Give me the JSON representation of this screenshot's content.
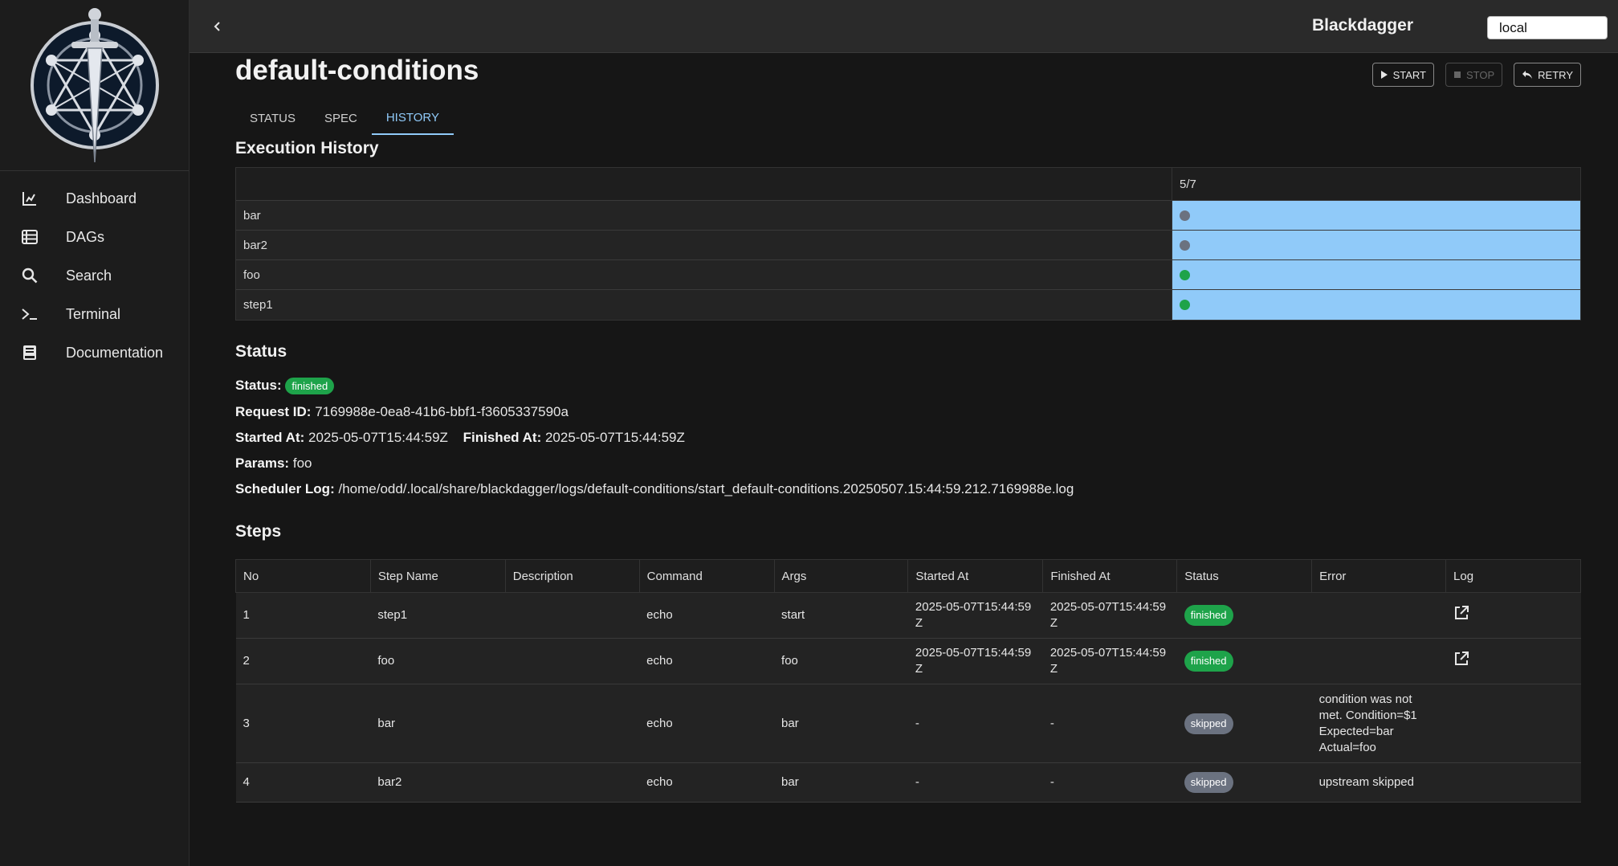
{
  "header": {
    "brand": "Blackdagger",
    "env_value": "local"
  },
  "sidebar": {
    "items": [
      {
        "label": "Dashboard",
        "icon": "chart-icon"
      },
      {
        "label": "DAGs",
        "icon": "list-icon"
      },
      {
        "label": "Search",
        "icon": "search-icon"
      },
      {
        "label": "Terminal",
        "icon": "terminal-icon"
      },
      {
        "label": "Documentation",
        "icon": "book-icon"
      }
    ]
  },
  "page": {
    "title": "default-conditions",
    "actions": {
      "start": "START",
      "stop": "STOP",
      "retry": "RETRY"
    },
    "tabs": [
      {
        "label": "STATUS",
        "active": false
      },
      {
        "label": "SPEC",
        "active": false
      },
      {
        "label": "HISTORY",
        "active": true
      }
    ]
  },
  "history": {
    "title": "Execution History",
    "run_label": "5/7",
    "rows": [
      {
        "name": "bar",
        "dot_color": "#6b7280"
      },
      {
        "name": "bar2",
        "dot_color": "#6b7280"
      },
      {
        "name": "foo",
        "dot_color": "#1ea34a"
      },
      {
        "name": "step1",
        "dot_color": "#1ea34a"
      }
    ]
  },
  "status": {
    "title": "Status",
    "status_label": "Status:",
    "status_value": "finished",
    "request_id_label": "Request ID:",
    "request_id": "7169988e-0ea8-41b6-bbf1-f3605337590a",
    "started_label": "Started At:",
    "started_at": "2025-05-07T15:44:59Z",
    "finished_label": "Finished At:",
    "finished_at": "2025-05-07T15:44:59Z",
    "params_label": "Params:",
    "params": "foo",
    "log_label": "Scheduler Log:",
    "log_path": "/home/odd/.local/share/blackdagger/logs/default-conditions/start_default-conditions.20250507.15:44:59.212.7169988e.log"
  },
  "steps": {
    "title": "Steps",
    "columns": [
      "No",
      "Step Name",
      "Description",
      "Command",
      "Args",
      "Started At",
      "Finished At",
      "Status",
      "Error",
      "Log"
    ],
    "rows": [
      {
        "no": "1",
        "name": "step1",
        "description": "",
        "command": "echo",
        "args": "start",
        "started": "2025-05-07T15:44:59Z",
        "finished": "2025-05-07T15:44:59Z",
        "status": "finished",
        "error": "",
        "has_log": true
      },
      {
        "no": "2",
        "name": "foo",
        "description": "",
        "command": "echo",
        "args": "foo",
        "started": "2025-05-07T15:44:59Z",
        "finished": "2025-05-07T15:44:59Z",
        "status": "finished",
        "error": "",
        "has_log": true
      },
      {
        "no": "3",
        "name": "bar",
        "description": "",
        "command": "echo",
        "args": "bar",
        "started": "-",
        "finished": "-",
        "status": "skipped",
        "error": "condition was not met. Condition=$1 Expected=bar Actual=foo",
        "has_log": false
      },
      {
        "no": "4",
        "name": "bar2",
        "description": "",
        "command": "echo",
        "args": "bar",
        "started": "-",
        "finished": "-",
        "status": "skipped",
        "error": "upstream skipped",
        "has_log": false
      }
    ]
  }
}
